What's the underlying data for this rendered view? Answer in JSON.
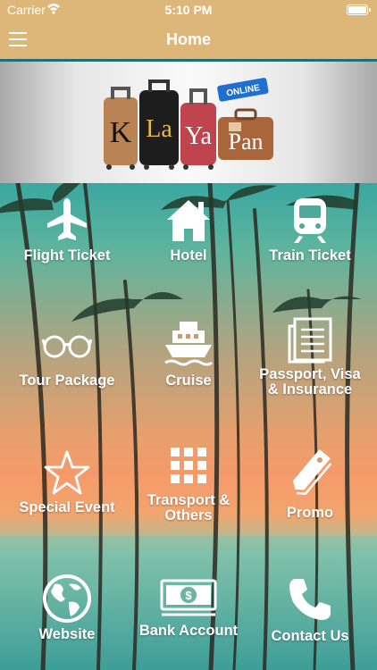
{
  "status_bar": {
    "carrier": "Carrier",
    "time": "5:10 PM"
  },
  "nav": {
    "title": "Home"
  },
  "banner": {
    "logo_letters": [
      "K",
      "La",
      "Ya",
      "Pan"
    ],
    "tag": "ONLINE"
  },
  "grid": {
    "flight": "Flight Ticket",
    "hotel": "Hotel",
    "train": "Train Ticket",
    "tour": "Tour Package",
    "cruise": "Cruise",
    "passport": [
      "Passport, Visa",
      "& Insurance"
    ],
    "event": "Special Event",
    "transport": [
      "Transport &",
      "Others"
    ],
    "promo": "Promo",
    "website": "Website",
    "bank": "Bank Account",
    "contact": "Contact Us"
  },
  "colors": {
    "header": "#ddb77a",
    "accent_line": "#1d6f74"
  }
}
